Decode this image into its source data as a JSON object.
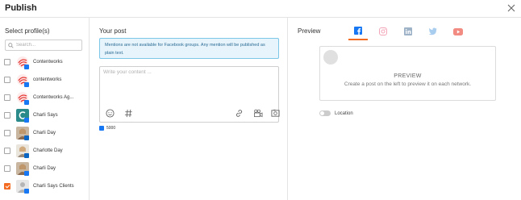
{
  "header": {
    "title": "Publish"
  },
  "left": {
    "title": "Select profile(s)",
    "search_placeholder": "Search...",
    "profiles": [
      {
        "name": "Contentworks",
        "checked": false,
        "avatar": "contentworks-logo-icon"
      },
      {
        "name": "contentworks",
        "checked": false,
        "avatar": "contentworks-logo-icon"
      },
      {
        "name": "Contentworks Ag...",
        "checked": false,
        "avatar": "contentworks-logo-icon"
      },
      {
        "name": "Charli Says",
        "checked": false,
        "avatar": "charli-says-logo-icon"
      },
      {
        "name": "Charli Day",
        "checked": false,
        "avatar": "person-photo-icon"
      },
      {
        "name": "Charlotte Day",
        "checked": false,
        "avatar": "person-photo-icon"
      },
      {
        "name": "Charli Day",
        "checked": false,
        "avatar": "person-photo-icon"
      },
      {
        "name": "Charli Says Clients",
        "checked": true,
        "avatar": "default-avatar-icon"
      }
    ]
  },
  "middle": {
    "title": "Your post",
    "notice": "Mentions are not available for Facebook groups. Any mention will be published as plain text.",
    "content_placeholder": "Write your content ...",
    "char_count": "5000"
  },
  "right": {
    "title": "Preview",
    "tabs": [
      "facebook-icon",
      "instagram-icon",
      "linkedin-icon",
      "twitter-icon",
      "youtube-icon"
    ],
    "active_tab": "facebook-icon",
    "preview_title": "PREVIEW",
    "preview_subtitle": "Create a post on the left to preview it on each network.",
    "location_label": "Location"
  },
  "colors": {
    "accent": "#f36b21",
    "facebook": "#1877f2",
    "notice_bg": "#e8f4fb",
    "notice_border": "#7cc6e8"
  }
}
